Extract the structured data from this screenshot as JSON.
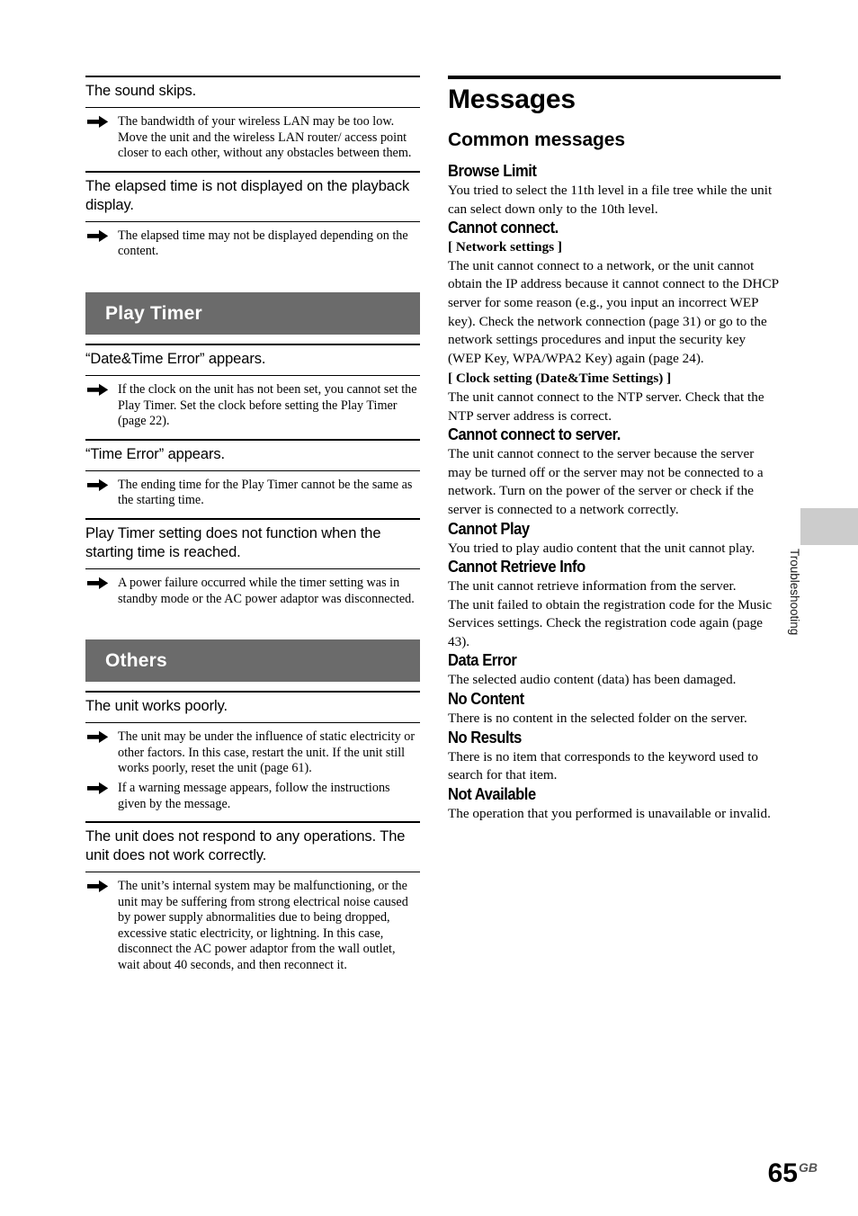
{
  "page": {
    "number": "65",
    "number_suffix": "GB"
  },
  "side_tab": {
    "label": "Troubleshooting"
  },
  "left_column": {
    "blocks": [
      {
        "kind": "symptom",
        "symptom": "The sound skips.",
        "remedies": [
          "The bandwidth of your wireless LAN may be too low. Move the unit and the wireless LAN router/ access point closer to each other, without any obstacles between them."
        ]
      },
      {
        "kind": "symptom",
        "symptom": "The elapsed time is not displayed on the playback display.",
        "remedies": [
          "The elapsed time may not be displayed depending on the content."
        ]
      },
      {
        "kind": "section",
        "title": "Play Timer"
      },
      {
        "kind": "symptom",
        "symptom": "“Date&Time Error” appears.",
        "remedies": [
          "If the clock on the unit has not been set, you cannot set the Play Timer. Set the clock before setting the Play Timer (page 22)."
        ]
      },
      {
        "kind": "symptom",
        "symptom": "“Time Error” appears.",
        "remedies": [
          "The ending time for the Play Timer cannot be the same as the starting time."
        ]
      },
      {
        "kind": "symptom",
        "symptom": "Play Timer setting does not function when the starting time is reached.",
        "remedies": [
          "A power failure occurred while the timer setting was in standby mode or the AC power adaptor was disconnected."
        ]
      },
      {
        "kind": "section",
        "title": "Others"
      },
      {
        "kind": "symptom",
        "symptom": "The unit works poorly.",
        "remedies": [
          "The unit may be under the influence of static electricity or other factors. In this case, restart the unit. If the unit still works poorly, reset the unit (page 61).",
          "If a warning message appears, follow the instructions given by the message."
        ]
      },
      {
        "kind": "symptom",
        "symptom": "The unit does not respond to any operations. The unit does not work correctly.",
        "remedies": [
          "The unit’s internal system may be malfunctioning, or the unit may be suffering from strong electrical noise caused by power supply abnormalities due to being dropped, excessive static electricity, or lightning. In this case, disconnect the AC power adaptor from the wall outlet, wait about 40 seconds, and then reconnect it."
        ]
      }
    ]
  },
  "right_column": {
    "chapter_title": "Messages",
    "section_title": "Common messages",
    "messages": [
      {
        "title": "Browse Limit",
        "parts": [
          {
            "type": "body",
            "text": "You tried to select the 11th level in a file tree while the unit can select down only to the 10th level."
          }
        ]
      },
      {
        "title": "Cannot connect.",
        "parts": [
          {
            "type": "sub",
            "text": "[ Network settings ]"
          },
          {
            "type": "body",
            "text": "The unit cannot connect to a network, or the unit cannot obtain the IP address because it cannot connect to the DHCP server for some reason (e.g., you input an incorrect WEP key). Check the network connection (page 31) or go to the network settings procedures and input the security key (WEP Key, WPA/WPA2 Key) again (page 24)."
          },
          {
            "type": "sub",
            "text": "[ Clock setting (Date&Time Settings) ]"
          },
          {
            "type": "body",
            "text": "The unit cannot connect to the NTP server. Check that the NTP server address is correct."
          }
        ]
      },
      {
        "title": "Cannot connect to server.",
        "parts": [
          {
            "type": "body",
            "text": "The unit cannot connect to the server because the server may be turned off or the server may not be connected to a network. Turn on the power of the server or check if the server is connected to a network correctly."
          }
        ]
      },
      {
        "title": "Cannot Play",
        "parts": [
          {
            "type": "body",
            "text": "You tried to play audio content that the unit cannot play."
          }
        ]
      },
      {
        "title": "Cannot Retrieve Info",
        "parts": [
          {
            "type": "body",
            "text": "The unit cannot retrieve information from the server."
          },
          {
            "type": "body",
            "text": "The unit failed to obtain the registration code for the Music Services settings. Check the registration code again (page 43)."
          }
        ]
      },
      {
        "title": "Data Error",
        "parts": [
          {
            "type": "body",
            "text": "The selected audio content (data) has been damaged."
          }
        ]
      },
      {
        "title": "No Content",
        "parts": [
          {
            "type": "body",
            "text": "There is no content in the selected folder on the server."
          }
        ]
      },
      {
        "title": "No Results",
        "parts": [
          {
            "type": "body",
            "text": "There is no item that corresponds to the keyword used to search for that item."
          }
        ]
      },
      {
        "title": "Not Available",
        "parts": [
          {
            "type": "body",
            "text": "The operation that you performed is unavailable or invalid."
          }
        ]
      }
    ]
  },
  "colors": {
    "section_bar_bg": "#6b6b6b",
    "side_tab_bg": "#cccccc",
    "text": "#000000"
  },
  "icons": {
    "remedy_bullet": "arrow-right-icon"
  }
}
